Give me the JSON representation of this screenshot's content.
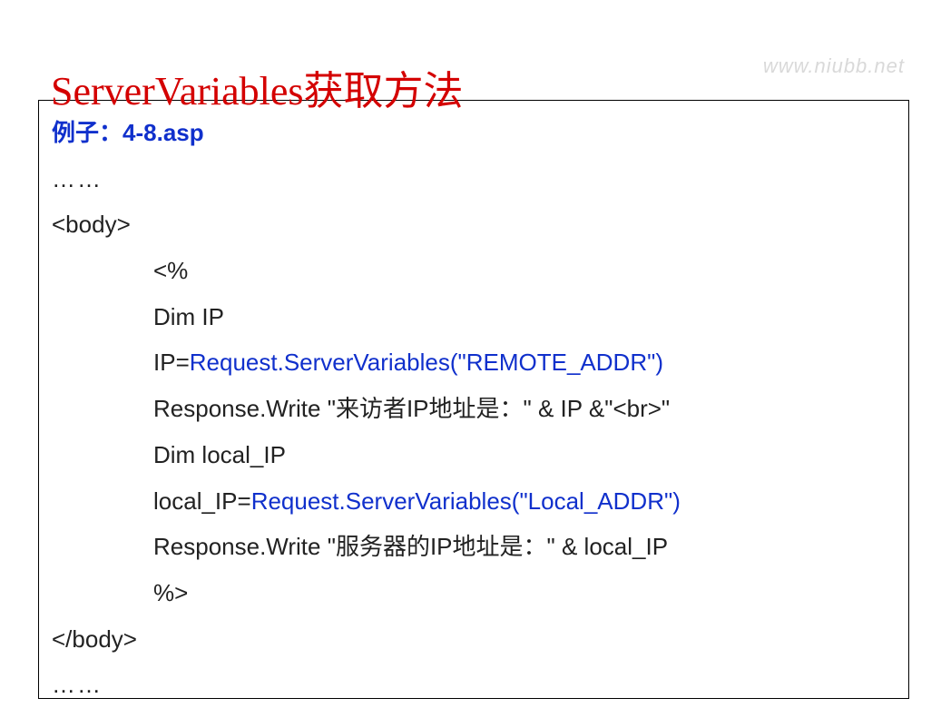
{
  "watermark": "www.niubb.net",
  "title": "ServerVariables获取方法",
  "example_label": "例子：",
  "example_file": "4-8.asp",
  "ellipsis": "……",
  "lines": {
    "body_open": "<body>",
    "open_asp": "<%",
    "dim_ip": "Dim IP",
    "ip_assign_lhs": "IP=",
    "ip_assign_rhs": "Request.ServerVariables(\"REMOTE_ADDR\")",
    "rw1_a": "Response.Write \"",
    "rw1_b": "来访者IP地址是：",
    "rw1_c": "\" & IP &\"<br>\"",
    "dim_local": "Dim local_IP",
    "local_assign_lhs": "local_IP=",
    "local_assign_rhs": "Request.ServerVariables(\"Local_ADDR\")",
    "rw2_a": "Response.Write \"",
    "rw2_b": "服务器的IP地址是：",
    "rw2_c": "\" & local_IP",
    "close_asp": "%>",
    "body_close": "</body>"
  }
}
